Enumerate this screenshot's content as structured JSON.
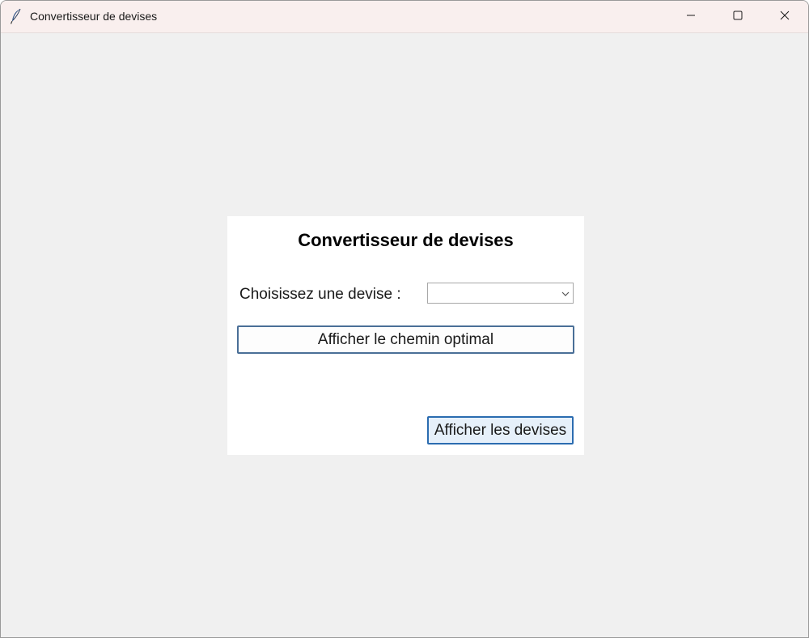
{
  "window": {
    "title": "Convertisseur de devises",
    "app_icon": "feather-icon",
    "controls": {
      "minimize_icon": "minimize-icon",
      "maximize_icon": "maximize-icon",
      "close_icon": "close-icon"
    }
  },
  "main": {
    "heading": "Convertisseur de devises",
    "currency_label": "Choisissez une devise :",
    "currency_select": {
      "value": "",
      "icon": "chevron-down-icon"
    },
    "show_path_button": "Afficher le chemin optimal",
    "show_currencies_button": "Afficher les devises"
  },
  "colors": {
    "titlebar_bg": "#f9efee",
    "client_bg": "#f0f0f0",
    "panel_bg": "#ffffff",
    "button_border": "#4a6f97",
    "focused_button_border": "#2b6cb0",
    "focused_button_bg": "#e6f0fa"
  }
}
